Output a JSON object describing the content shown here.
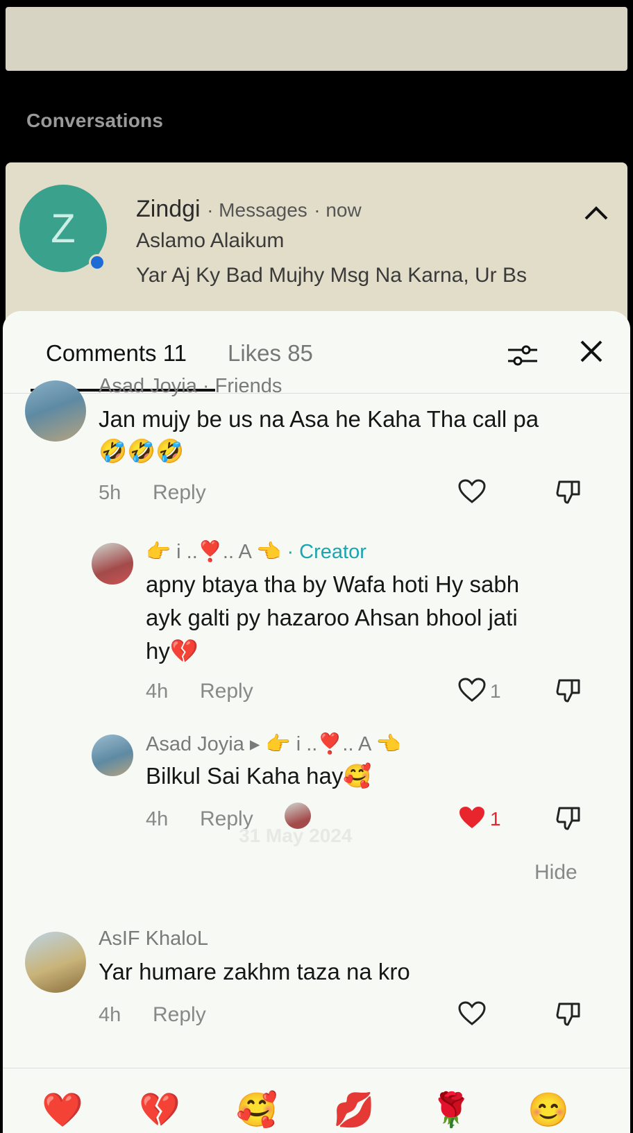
{
  "background": {
    "section_title": "Conversations",
    "notification": {
      "avatar_letter": "Z",
      "app_name": "Zindgi",
      "channel": "Messages",
      "time": "now",
      "line1": "Aslamo Alaikum",
      "line2": "Yar Aj Ky Bad Mujhy Msg Na Karna, Ur Bs"
    }
  },
  "sheet": {
    "tabs": {
      "comments": "Comments 11",
      "likes": "Likes 85"
    },
    "comments": [
      {
        "author": "Asad Joyia",
        "tag": "· Friends",
        "text": "Jan mujy be us na Asa he Kaha Tha call pa",
        "text2": "🤣🤣🤣",
        "time": "5h",
        "reply": "Reply"
      },
      {
        "author": "👉 i ..❣️.. A 👈",
        "tag": "· Creator",
        "text": "apny btaya tha by Wafa hoti Hy sabh",
        "text2": "ayk galti py hazaroo Ahsan bhool jati",
        "text3": "hy💔",
        "time": "4h",
        "reply": "Reply",
        "likes": "1"
      },
      {
        "author": "Asad Joyia ▸ 👉 i ..❣️.. A 👈",
        "text": "Bilkul Sai Kaha hay🥰",
        "time": "4h",
        "reply": "Reply",
        "likes": "1",
        "liked": true,
        "watermark": "31 May 2024"
      },
      {
        "author": "AsIF KhaloL",
        "text": "Yar humare zakhm taza na kro",
        "time": "4h",
        "reply": "Reply"
      }
    ],
    "hide_label": "Hide",
    "emoji_bar": [
      "❤️",
      "💔",
      "🥰",
      "💋",
      "🌹",
      "😊"
    ]
  },
  "colors": {
    "accent": "#19a6b0",
    "liked_heart": "#e8252c"
  }
}
